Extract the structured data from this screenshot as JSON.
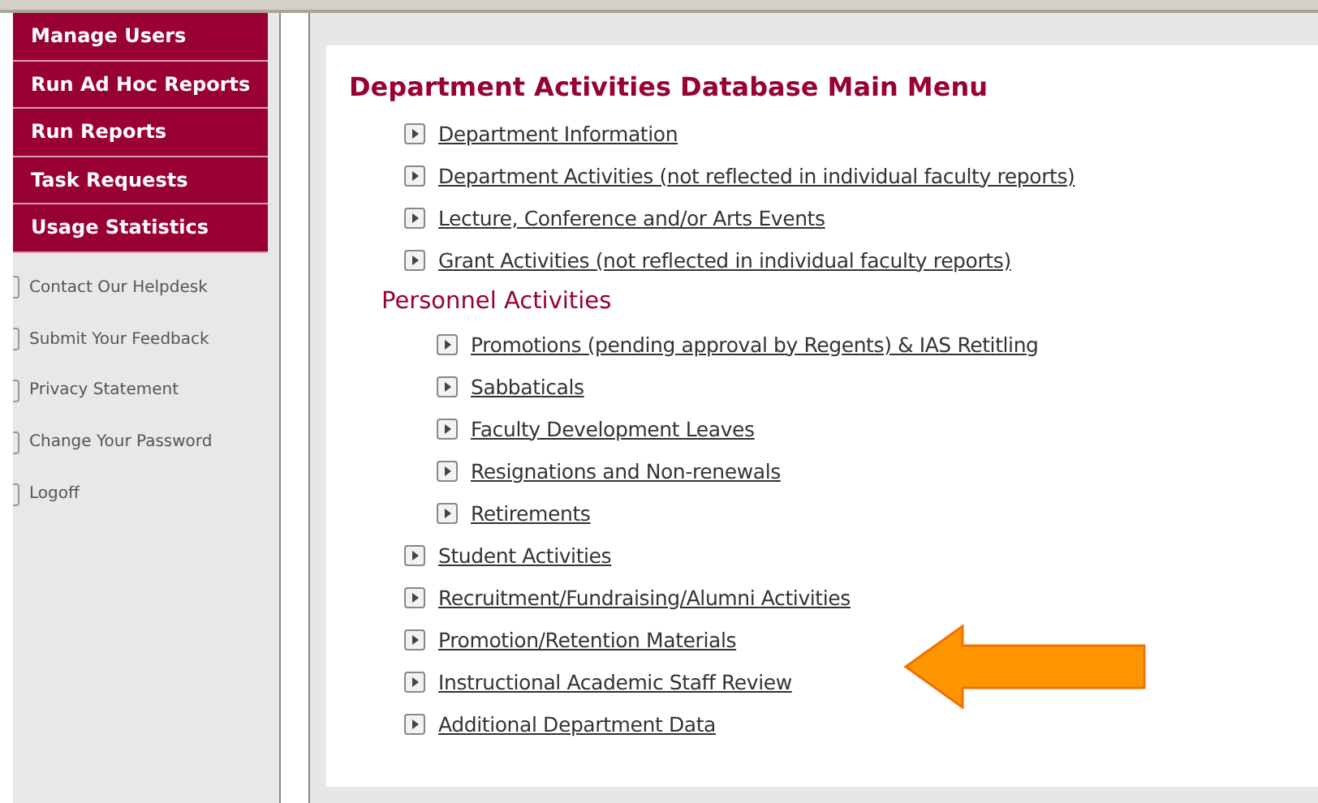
{
  "sidebar": {
    "menu": [
      {
        "label": "Manage Users"
      },
      {
        "label": "Run Ad Hoc Reports"
      },
      {
        "label": "Run Reports"
      },
      {
        "label": "Task Requests"
      },
      {
        "label": "Usage Statistics"
      }
    ],
    "links": [
      {
        "label": "Contact Our Helpdesk"
      },
      {
        "label": "Submit Your Feedback"
      },
      {
        "label": "Privacy Statement"
      },
      {
        "label": "Change Your Password"
      },
      {
        "label": "Logoff"
      }
    ]
  },
  "main": {
    "title": "Department Activities Database Main Menu",
    "items": [
      {
        "kind": "link",
        "label": "Department Information"
      },
      {
        "kind": "link",
        "label": "Department Activities (not reflected in individual faculty reports)"
      },
      {
        "kind": "link",
        "label": "Lecture, Conference and/or Arts Events"
      },
      {
        "kind": "link",
        "label": "Grant Activities (not reflected in individual faculty reports)"
      },
      {
        "kind": "section",
        "label": "Personnel Activities",
        "children": [
          {
            "kind": "link",
            "label": "Promotions (pending approval by Regents) & IAS Retitling"
          },
          {
            "kind": "link",
            "label": "Sabbaticals"
          },
          {
            "kind": "link",
            "label": "Faculty Development Leaves"
          },
          {
            "kind": "link",
            "label": "Resignations and Non-renewals"
          },
          {
            "kind": "link",
            "label": "Retirements"
          }
        ]
      },
      {
        "kind": "link",
        "label": "Student Activities"
      },
      {
        "kind": "link",
        "label": "Recruitment/Fundraising/Alumni Activities"
      },
      {
        "kind": "link",
        "label": "Promotion/Retention Materials"
      },
      {
        "kind": "link",
        "label": "Instructional Academic Staff Review"
      },
      {
        "kind": "link",
        "label": "Additional Department Data"
      }
    ]
  }
}
